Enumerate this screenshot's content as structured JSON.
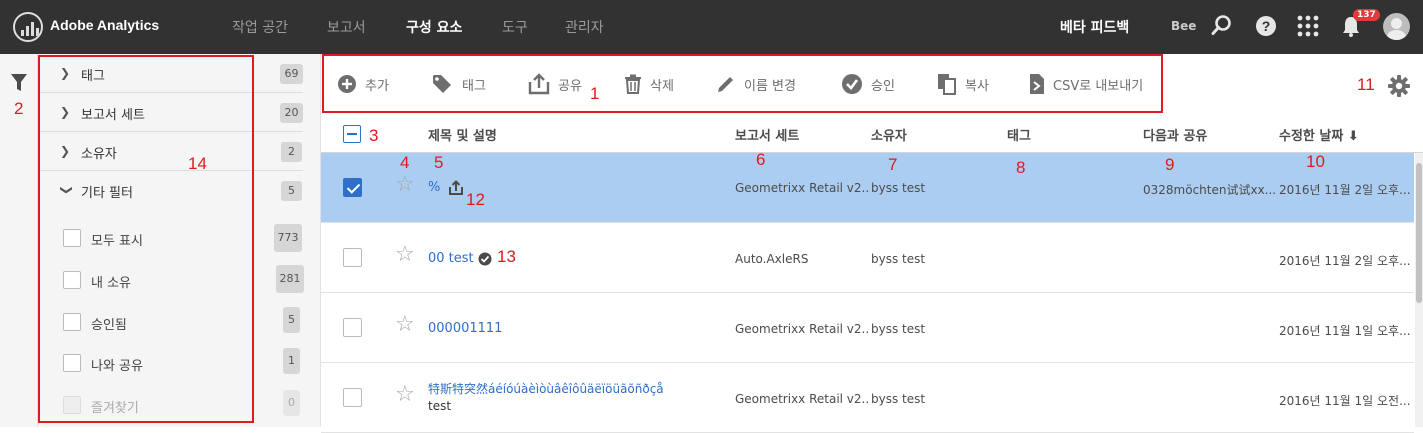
{
  "app": {
    "title": "Adobe Analytics"
  },
  "nav": {
    "items": [
      {
        "label": "작업 공간",
        "active": false
      },
      {
        "label": "보고서",
        "active": false
      },
      {
        "label": "구성 요소",
        "active": true
      },
      {
        "label": "도구",
        "active": false
      },
      {
        "label": "관리자",
        "active": false
      }
    ],
    "feedback": "베타 피드백",
    "user_initials": "Bee",
    "notification_count": "137"
  },
  "filters": {
    "sections": [
      {
        "label": "태그",
        "count": "69"
      },
      {
        "label": "보고서 세트",
        "count": "20"
      },
      {
        "label": "소유자",
        "count": "2"
      },
      {
        "label": "기타 필터",
        "count": "5"
      }
    ],
    "options": [
      {
        "label": "모두 표시",
        "count": "773"
      },
      {
        "label": "내 소유",
        "count": "281"
      },
      {
        "label": "승인됨",
        "count": "5"
      },
      {
        "label": "나와 공유",
        "count": "1"
      },
      {
        "label": "즐겨찾기",
        "count": "0"
      }
    ]
  },
  "toolbar": {
    "add": "추가",
    "tag": "태그",
    "share": "공유",
    "delete": "삭제",
    "rename": "이름 변경",
    "approve": "승인",
    "copy": "복사",
    "export": "CSV로 내보내기"
  },
  "table": {
    "headers": {
      "title": "제목 및 설명",
      "suite": "보고서 세트",
      "owner": "소유자",
      "tags": "태그",
      "shared": "다음과 공유",
      "modified": "수정한 날짜"
    },
    "rows": [
      {
        "title": "%",
        "suite": "Geometrixx Retail v2...",
        "owner": "byss test",
        "shared": "0328möchten试试xx...",
        "modified": "2016년 11월 2일 오후...",
        "selected": true
      },
      {
        "title": "00 test",
        "suite": "Auto.AxleRS",
        "owner": "byss test",
        "shared": "",
        "modified": "2016년 11월 2일 오후...",
        "selected": false
      },
      {
        "title": "000001111",
        "suite": "Geometrixx Retail v2...",
        "owner": "byss test",
        "shared": "",
        "modified": "2016년 11월 1일 오후...",
        "selected": false
      },
      {
        "title": "特斯特突然áéíóúàèìòùâêîôûäëïöüãõñðçå",
        "description": "test",
        "suite": "Geometrixx Retail v2...",
        "owner": "byss test",
        "shared": "",
        "modified": "2016년 11월 1일 오전...",
        "selected": false
      }
    ]
  },
  "annotations": [
    "1",
    "2",
    "3",
    "4",
    "5",
    "6",
    "7",
    "8",
    "9",
    "10",
    "11",
    "12",
    "13",
    "14"
  ],
  "colors": {
    "topbar": "#323232",
    "accent": "#2d6fcb",
    "selected_row": "#abcdf1",
    "annotation": "#e01b1b"
  }
}
